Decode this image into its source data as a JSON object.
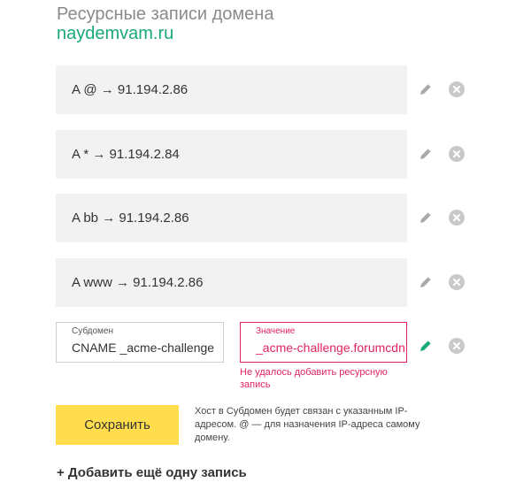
{
  "page": {
    "title": "Ресурсные записи домена",
    "domain": "naydemvam.ru"
  },
  "records": [
    {
      "text": "A @ → 91.194.2.86"
    },
    {
      "text": "A * → 91.194.2.84"
    },
    {
      "text": "A bb → 91.194.2.86"
    },
    {
      "text": "A www → 91.194.2.86"
    }
  ],
  "icons": {
    "edit": "pencil-icon",
    "delete": "close-circle-icon"
  },
  "form": {
    "subdomain_label": "Субдомен",
    "subdomain_value": "CNAME _acme-challenge",
    "value_label": "Значение",
    "value_value": "_acme-challenge.forumcdn",
    "error": "Не удалось добавить ресурсную запись",
    "save_label": "Сохранить",
    "hint": "Хост в Субдомен будет связан с указанным IP-адресом. @ — для назначения IP-адреса самому домену."
  },
  "add_link": "+ Добавить ещё одну запись",
  "colors": {
    "accent_green": "#19a974",
    "error_red": "#e0245e",
    "button_yellow": "#ffdd4d",
    "record_bg": "#f2f2f2"
  }
}
